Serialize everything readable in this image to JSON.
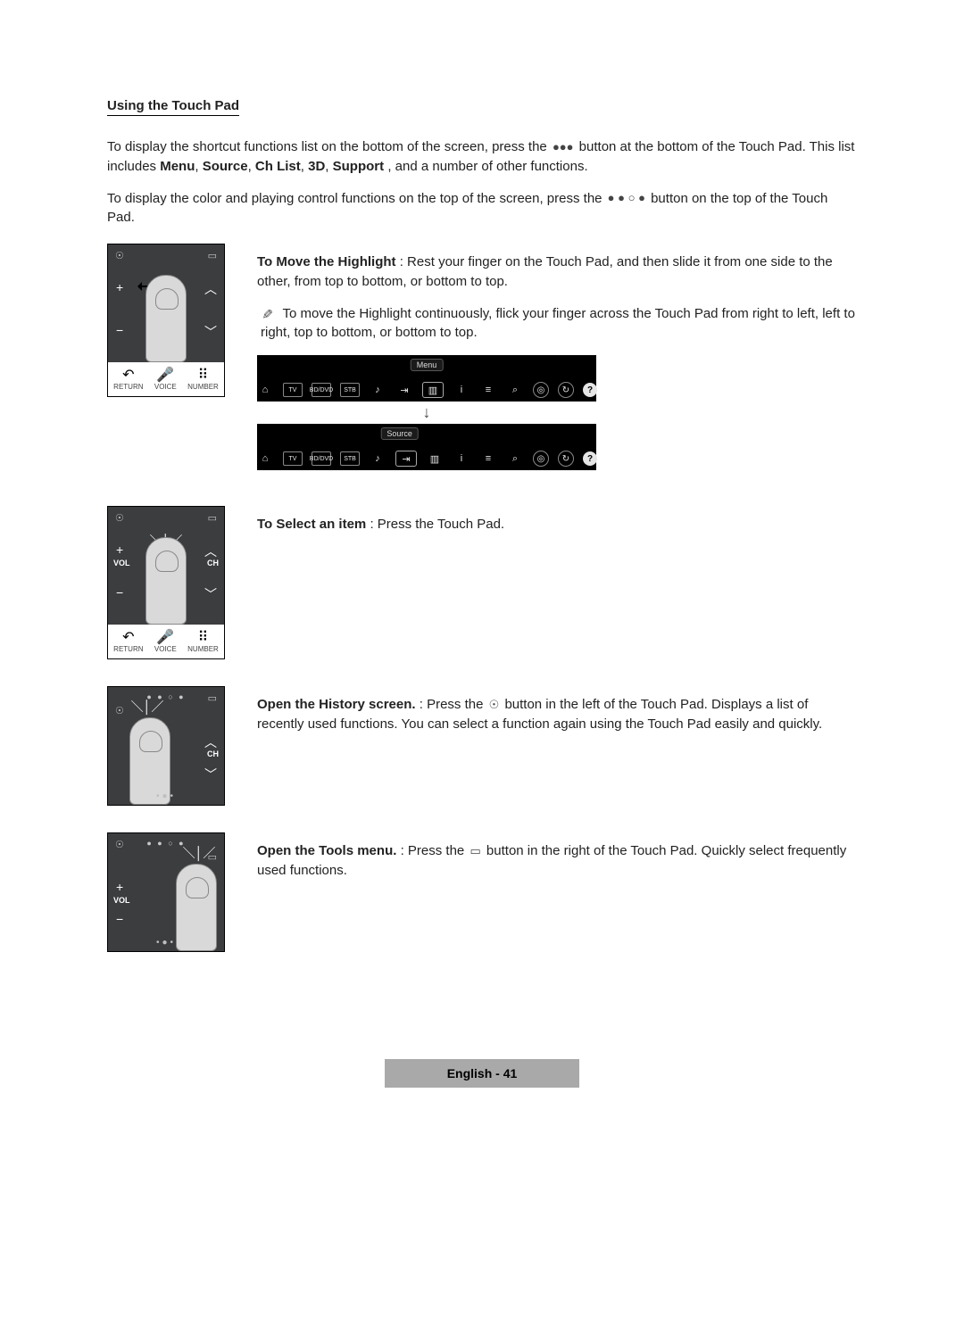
{
  "section_title": "Using the Touch Pad",
  "intro1_pre": "To display the shortcut functions list on the bottom of the screen, press the ",
  "intro1_icon": "●●●",
  "intro1_mid": " button at the bottom of the Touch Pad. This list includes ",
  "intro1_b1": "Menu",
  "intro1_b2": "Source",
  "intro1_b3": "Ch List",
  "intro1_b4": "3D",
  "intro1_b5": "Support",
  "intro1_post": ", and a number of other functions.",
  "intro2_pre": "To display the color and playing control functions on the top of the screen, press the ",
  "intro2_icon": "● ● ○ ●",
  "intro2_post": " button on the top of the Touch Pad.",
  "move_title": "To Move the Highlight",
  "move_text": ": Rest your finger on the Touch Pad, and then slide it from one side to the other, from top to bottom, or bottom to top.",
  "move_note": "To move the Highlight continuously, flick your finger across the Touch Pad from right to left, left to right, top to bottom, or bottom to top.",
  "toolbar_label_menu": "Menu",
  "toolbar_label_source": "Source",
  "toolbar_items": {
    "smarthub": "⌂",
    "tv": "TV",
    "bddvd": "BD/DVD",
    "stb": "STB",
    "audio": "♪",
    "source": "⇥",
    "menu": "▥",
    "info": "i",
    "chlist": "≡",
    "search": "⌕",
    "locate": "◎",
    "refresh": "↻",
    "help": "?"
  },
  "select_title": "To Select an item",
  "select_text": ": Press the Touch Pad.",
  "history_title": "Open the History screen.",
  "history_pre": ": Press the ",
  "history_icon": "☉",
  "history_post": " button in the left of the Touch Pad. Displays a list of recently used functions. You can select a function again using the Touch Pad easily and quickly.",
  "tools_title": "Open the Tools menu.",
  "tools_pre": ": Press the ",
  "tools_icon": "▭",
  "tools_post": " button in the right of the Touch Pad. Quickly select frequently used functions.",
  "remote_labels": {
    "vol": "VOL",
    "ch": "CH",
    "return": "RETURN",
    "voice": "VOICE",
    "number": "NUMBER",
    "return_glyph": "↶",
    "voice_glyph": "🎤",
    "number_glyph": "⠿"
  },
  "footer": "English - 41"
}
